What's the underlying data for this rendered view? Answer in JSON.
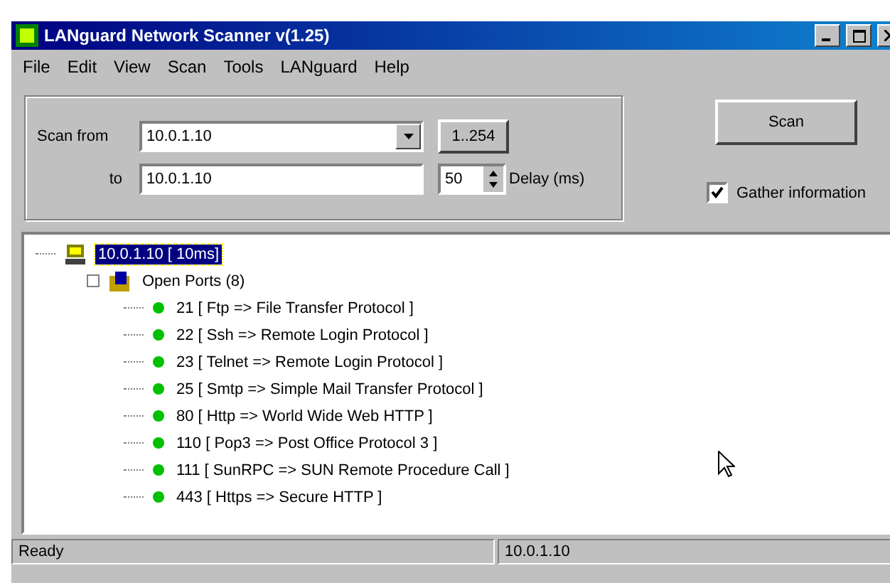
{
  "window": {
    "title": "LANguard Network Scanner v(1.25)"
  },
  "menu": [
    "File",
    "Edit",
    "View",
    "Scan",
    "Tools",
    "LANguard",
    "Help"
  ],
  "scan_range": {
    "from_label": "Scan from",
    "from_value": "10.0.1.10",
    "range_button": "1..254",
    "to_label": "to",
    "to_value": "10.0.1.10",
    "delay_value": "50",
    "delay_label": "Delay (ms)"
  },
  "scan_button": "Scan",
  "gather_information": {
    "label": "Gather information",
    "checked": true
  },
  "tree": {
    "label": "10.0.1.10 [ 10ms]",
    "selected": true,
    "children": [
      {
        "label": "Open Ports (8)",
        "children": [
          {
            "label": "21 [ Ftp => File Transfer Protocol ]"
          },
          {
            "label": "22 [ Ssh => Remote Login Protocol ]"
          },
          {
            "label": "23 [ Telnet => Remote Login Protocol ]"
          },
          {
            "label": "25 [ Smtp => Simple Mail Transfer Protocol ]"
          },
          {
            "label": "80 [ Http => World Wide Web HTTP ]"
          },
          {
            "label": "110 [ Pop3 => Post Office Protocol 3 ]"
          },
          {
            "label": "111 [ SunRPC => SUN Remote Procedure Call ]"
          },
          {
            "label": "443 [ Https => Secure HTTP ]"
          }
        ]
      }
    ]
  },
  "status_bar": [
    "Ready",
    "10.0.1.10"
  ]
}
